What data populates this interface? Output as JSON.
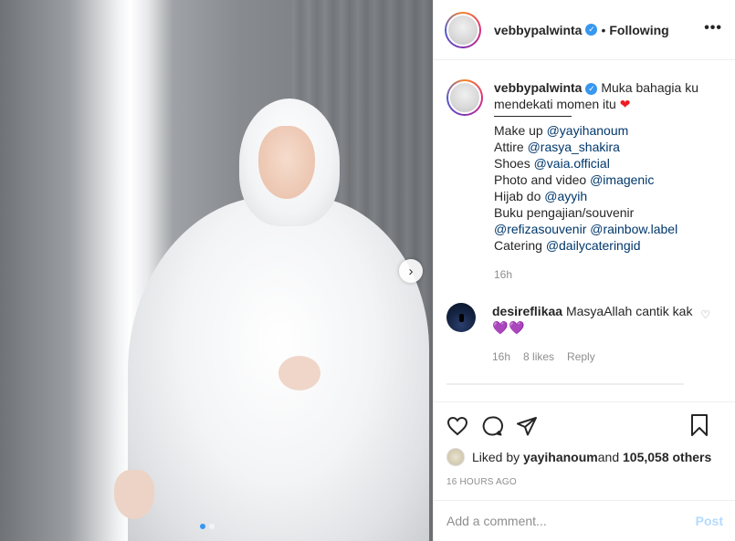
{
  "post": {
    "username": "vebbypalwinta",
    "separator": "•",
    "follow_status": "Following",
    "more_icon": "•••"
  },
  "caption": {
    "username": "vebbypalwinta",
    "text": "Muka bahagia ku mendekati momen itu",
    "emoji": "❤",
    "lines": [
      {
        "label": "Make up ",
        "mention": "@yayihanoum"
      },
      {
        "label": "Attire ",
        "mention": "@rasya_shakira"
      },
      {
        "label": "Shoes ",
        "mention": "@vaia.official"
      },
      {
        "label": "Photo and video ",
        "mention": "@imagenic"
      },
      {
        "label": "Hijab do ",
        "mention": "@ayyih"
      },
      {
        "label": "Buku pengajian/souvenir",
        "mention": ""
      },
      {
        "label": "",
        "mention": "@refizasouvenir @rainbow.label"
      },
      {
        "label": "Catering ",
        "mention": "@dailycateringid"
      }
    ],
    "time": "16h"
  },
  "comment": {
    "username": "desireflikaa",
    "text": "MasyaAllah cantik kak",
    "emoji": "💜💜",
    "time": "16h",
    "likes": "8 likes",
    "reply": "Reply"
  },
  "likes": {
    "prefix": "Liked by ",
    "user": "yayihanoum",
    "middle": " and ",
    "count": "105,058 others"
  },
  "timestamp": "16 HOURS AGO",
  "add_comment": {
    "placeholder": "Add a comment...",
    "post_label": "Post"
  },
  "colors": {
    "verified": "#3897f0",
    "link": "#00376b",
    "post_disabled": "#b3dbff"
  },
  "icons": [
    "verified-badge-icon",
    "more-options-icon",
    "next-arrow-icon",
    "heart-icon",
    "comment-icon",
    "share-icon",
    "bookmark-icon",
    "like-comment-icon"
  ]
}
